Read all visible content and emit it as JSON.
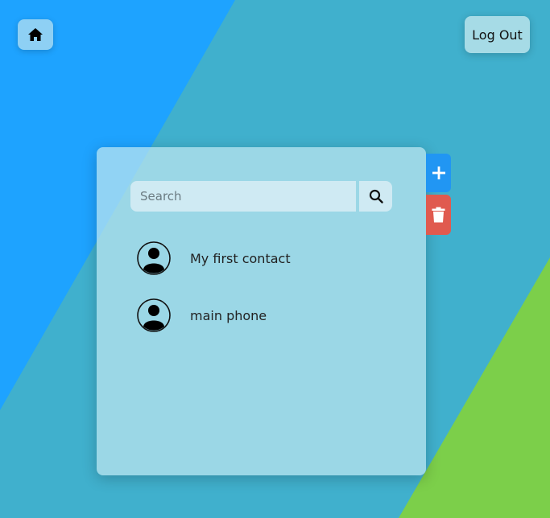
{
  "colors": {
    "bg_left": "#1ea3ff",
    "bg_mid": "#40b0cd",
    "bg_green": "#7ccf4a",
    "panel": "#bee6f0",
    "add": "#2196f3",
    "delete": "#e05a4f"
  },
  "header": {
    "home_icon": "home-icon",
    "logout_label": "Log Out"
  },
  "search": {
    "placeholder": "Search",
    "value": "",
    "icon": "search-icon"
  },
  "contacts": [
    {
      "name": "My first contact",
      "icon": "person-icon"
    },
    {
      "name": "main phone",
      "icon": "person-icon"
    }
  ],
  "side_actions": {
    "add_icon": "plus-icon",
    "delete_icon": "trash-icon"
  }
}
